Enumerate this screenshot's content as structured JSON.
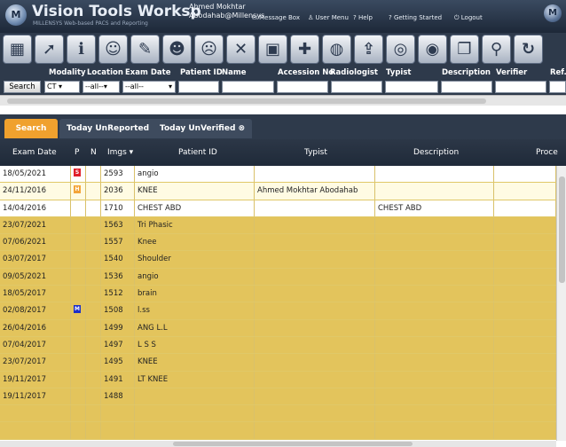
{
  "header": {
    "logo_letter": "M",
    "title": "Vision Tools Worksp",
    "subtitle": "MILLENSYS Web-based PACS and Reporting",
    "user_name": "Ahmed Mokhtar",
    "user_email": "Abodahab@Millensys",
    "menu": [
      {
        "icon": "message-icon",
        "label": "Message Box"
      },
      {
        "icon": "user-icon",
        "label": "User Menu"
      },
      {
        "icon": "help-icon",
        "label": "Help"
      },
      {
        "icon": "question-icon",
        "label": "Getting Started"
      },
      {
        "icon": "power-icon",
        "label": "Logout"
      }
    ]
  },
  "toolbar": [
    {
      "icon": "grid-layout-icon",
      "glyph": "▦"
    },
    {
      "icon": "report-icon",
      "glyph": "➚"
    },
    {
      "icon": "info-icon",
      "glyph": "ℹ"
    },
    {
      "icon": "patient-icon",
      "glyph": "☺"
    },
    {
      "icon": "edit-report-icon",
      "glyph": "✎"
    },
    {
      "icon": "doctor-icon",
      "glyph": "☻"
    },
    {
      "icon": "delete-patient-icon",
      "glyph": "☹"
    },
    {
      "icon": "close-icon",
      "glyph": "✕"
    },
    {
      "icon": "image-viewer-icon",
      "glyph": "▣"
    },
    {
      "icon": "add-icon",
      "glyph": "✚"
    },
    {
      "icon": "globe-icon",
      "glyph": "◍"
    },
    {
      "icon": "upload-icon",
      "glyph": "⇪"
    },
    {
      "icon": "burn-cd-icon",
      "glyph": "◎"
    },
    {
      "icon": "disc-icon",
      "glyph": "◉"
    },
    {
      "icon": "copy-icon",
      "glyph": "❐"
    },
    {
      "icon": "search-icon",
      "glyph": "⚲"
    },
    {
      "icon": "refresh-icon",
      "glyph": "↻"
    }
  ],
  "filters": {
    "labels": [
      "Modality",
      "Location",
      "Exam Date",
      "Patient ID",
      "Name",
      "Accession No",
      "Radiologist",
      "Typist",
      "Description",
      "Verifier",
      "Ref."
    ],
    "search_button": "Search",
    "modality_value": "CT",
    "location_value": "--all--",
    "exam_date_value": "--all--"
  },
  "tabs": [
    {
      "label": "Search"
    },
    {
      "label": "Today UnReported ⊗"
    },
    {
      "label": "Today UnVerified ⊗"
    }
  ],
  "columns": [
    "Exam Date",
    "P",
    "N",
    "Imgs ▾",
    "Patient ID",
    "Typist",
    "Description",
    "Proce"
  ],
  "rows": [
    {
      "date": "18/05/2021",
      "flag": "S",
      "flag_color": "#e0202a",
      "imgs": "2593",
      "pid": "angio",
      "typist": "",
      "desc": "",
      "bg": "#ffffff"
    },
    {
      "date": "24/11/2016",
      "flag": "H",
      "flag_color": "#f4a53a",
      "imgs": "2036",
      "pid": "KNEE",
      "typist": "Ahmed Mokhtar Abodahab",
      "desc": "",
      "bg": "#fffbe3"
    },
    {
      "date": "14/04/2016",
      "flag": "",
      "flag_color": "",
      "imgs": "1710",
      "pid": "CHEST ABD",
      "typist": "",
      "desc": "CHEST ABD",
      "bg": "#ffffff"
    },
    {
      "date": "23/07/2021",
      "flag": "",
      "flag_color": "",
      "imgs": "1563",
      "pid": "Tri Phasic",
      "typist": "",
      "desc": "",
      "bg": "#e3c45c"
    },
    {
      "date": "07/06/2021",
      "flag": "",
      "flag_color": "",
      "imgs": "1557",
      "pid": "Knee",
      "typist": "",
      "desc": "",
      "bg": "#e3c45c"
    },
    {
      "date": "03/07/2017",
      "flag": "",
      "flag_color": "",
      "imgs": "1540",
      "pid": "Shoulder",
      "typist": "",
      "desc": "",
      "bg": "#e3c45c"
    },
    {
      "date": "09/05/2021",
      "flag": "",
      "flag_color": "",
      "imgs": "1536",
      "pid": "angio",
      "typist": "",
      "desc": "",
      "bg": "#e3c45c"
    },
    {
      "date": "18/05/2017",
      "flag": "",
      "flag_color": "",
      "imgs": "1512",
      "pid": "brain",
      "typist": "",
      "desc": "",
      "bg": "#e3c45c"
    },
    {
      "date": "02/08/2017",
      "flag": "M",
      "flag_color": "#1b2ec8",
      "imgs": "1508",
      "pid": "l.ss",
      "typist": "",
      "desc": "",
      "bg": "#e3c45c"
    },
    {
      "date": "26/04/2016",
      "flag": "",
      "flag_color": "",
      "imgs": "1499",
      "pid": "ANG L.L",
      "typist": "",
      "desc": "",
      "bg": "#e3c45c"
    },
    {
      "date": "07/04/2017",
      "flag": "",
      "flag_color": "",
      "imgs": "1497",
      "pid": "L S S",
      "typist": "",
      "desc": "",
      "bg": "#e3c45c"
    },
    {
      "date": "23/07/2017",
      "flag": "",
      "flag_color": "",
      "imgs": "1495",
      "pid": "KNEE",
      "typist": "",
      "desc": "",
      "bg": "#e3c45c"
    },
    {
      "date": "19/11/2017",
      "flag": "",
      "flag_color": "",
      "imgs": "1491",
      "pid": "LT KNEE",
      "typist": "",
      "desc": "",
      "bg": "#e3c45c"
    },
    {
      "date": "19/11/2017",
      "flag": "",
      "flag_color": "",
      "imgs": "1488",
      "pid": "",
      "typist": "",
      "desc": "",
      "bg": "#e3c45c"
    },
    {
      "date": "",
      "flag": "",
      "flag_color": "",
      "imgs": "",
      "pid": "",
      "typist": "",
      "desc": "",
      "bg": "#e3c45c"
    },
    {
      "date": "",
      "flag": "",
      "flag_color": "",
      "imgs": "",
      "pid": "",
      "typist": "",
      "desc": "",
      "bg": "#e3c45c"
    }
  ],
  "colors": {
    "accent": "#f0a12e",
    "header_bg": "#2e3a4b",
    "row_highlight": "#e3c45c"
  }
}
